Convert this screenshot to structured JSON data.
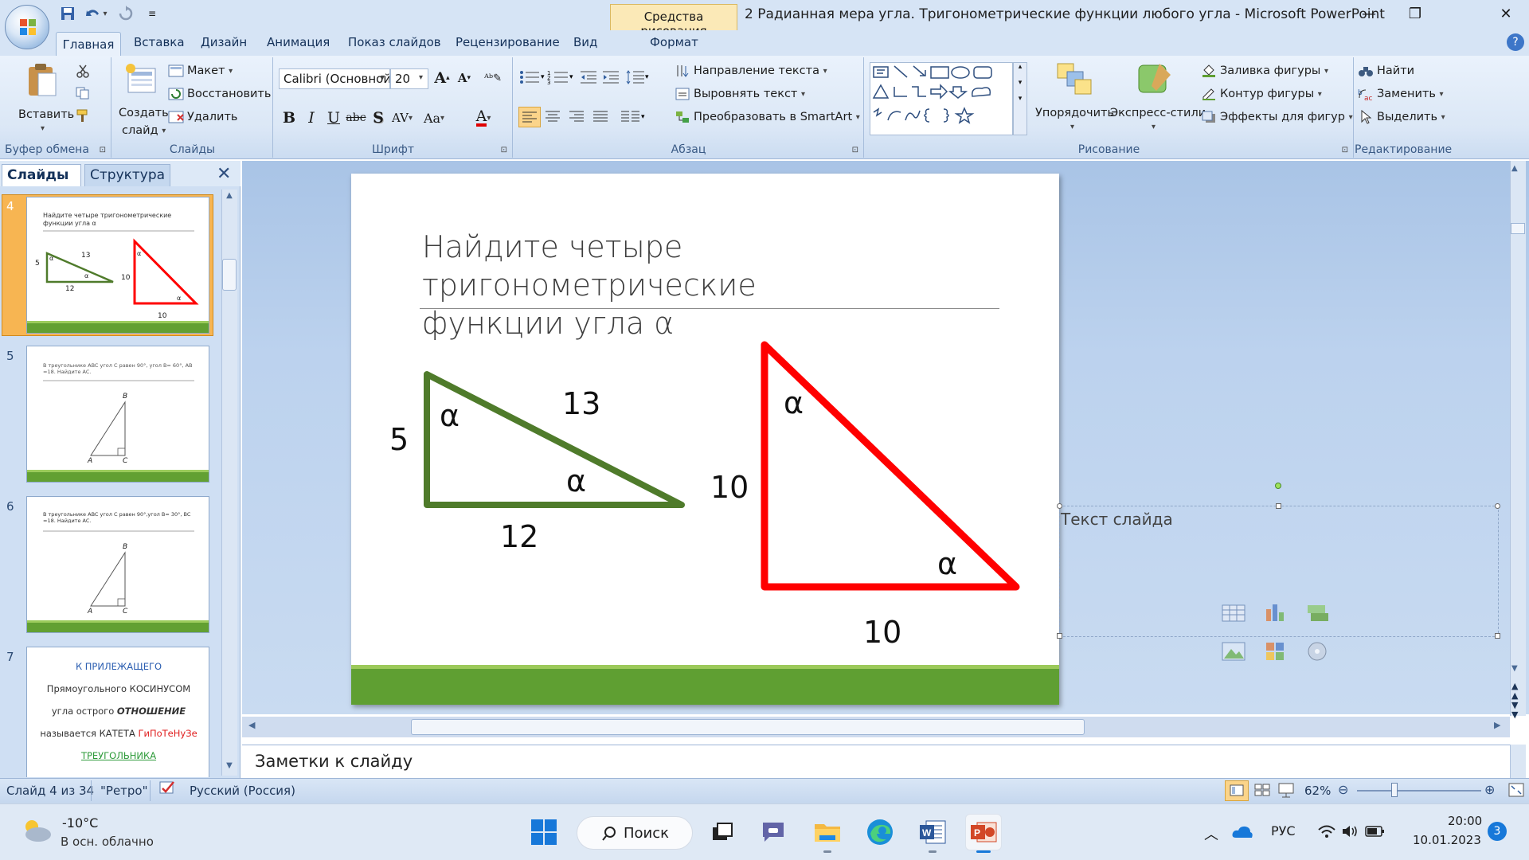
{
  "window": {
    "context_tab": "Средства рисования",
    "title": "2  Радианная мера угла.  Тригонометрические функции  любого угла - Microsoft PowerPoint"
  },
  "tabs": [
    "Главная",
    "Вставка",
    "Дизайн",
    "Анимация",
    "Показ слайдов",
    "Рецензирование",
    "Вид",
    "Формат"
  ],
  "ribbon": {
    "clipboard": {
      "paste": "Вставить",
      "label": "Буфер обмена"
    },
    "slides": {
      "new_slide_1": "Создать",
      "new_slide_2": "слайд",
      "layout": "Макет",
      "reset": "Восстановить",
      "delete": "Удалить",
      "label": "Слайды"
    },
    "font": {
      "family": "Calibri (Основной",
      "size": "20",
      "label": "Шрифт"
    },
    "paragraph": {
      "direction": "Направление текста",
      "align": "Выровнять текст",
      "smartart": "Преобразовать в SmartArt",
      "label": "Абзац"
    },
    "drawing": {
      "arrange": "Упорядочить",
      "quick_styles": "Экспресс-стили",
      "fill": "Заливка фигуры",
      "outline": "Контур фигуры",
      "effects": "Эффекты для фигур",
      "label": "Рисование"
    },
    "editing": {
      "find": "Найти",
      "replace": "Заменить",
      "select": "Выделить",
      "label": "Редактирование"
    }
  },
  "panel": {
    "tab_slides": "Слайды",
    "tab_outline": "Структура"
  },
  "thumbs": {
    "t4": {
      "num": "4",
      "title": "Найдите четыре тригонометрические функции угла α",
      "a": "5",
      "b": "13",
      "c": "12",
      "d": "10",
      "e": "10",
      "alpha": "α"
    },
    "t5": {
      "num": "5",
      "text": "В треугольнике ABC угол C равен 90°, угол B= 60°, AB =18.  Найдите AC.",
      "B": "B",
      "A": "A",
      "C": "C"
    },
    "t6": {
      "num": "6",
      "text": "В треугольнике ABC угол C равен 90°,угол B= 30°, BC =18.  Найдите AC.",
      "B": "B",
      "A": "A",
      "C": "C"
    },
    "t7": {
      "num": "7",
      "l1": "К ПРИЛЕЖАЩЕГО",
      "l2": "Прямоугольного КОСИНУСОМ",
      "l3a": "угла острого ",
      "l3b": "ОТНОШЕНИЕ",
      "l4a": "называется КАТЕТА ",
      "l4b": "ГиПоТеНуЗе",
      "l5": "ТРЕУГОЛЬНИКА"
    }
  },
  "slide": {
    "title_line1": "Найдите четыре тригонометрические",
    "title_line2": "функции угла α",
    "green": {
      "leg_left": "5",
      "hyp": "13",
      "leg_bottom": "12",
      "alpha_top": "α",
      "alpha_right": "α"
    },
    "red": {
      "leg_left": "10",
      "leg_bottom": "10",
      "alpha_top": "α",
      "alpha_right": "α"
    },
    "placeholder": "Текст слайда"
  },
  "notes": "Заметки к слайду",
  "status": {
    "slide": "Слайд 4 из 34",
    "theme": "\"Ретро\"",
    "lang": "Русский (Россия)",
    "zoom": "62%"
  },
  "taskbar": {
    "temp": "-10°C",
    "weather": "В осн. облачно",
    "search": "Поиск",
    "lang": "РУС",
    "time": "20:00",
    "date": "10.01.2023",
    "badge": "3"
  },
  "colors": {
    "green": "#4f7b2b",
    "red": "#ff0000",
    "accent_green": "#5f9f32"
  }
}
